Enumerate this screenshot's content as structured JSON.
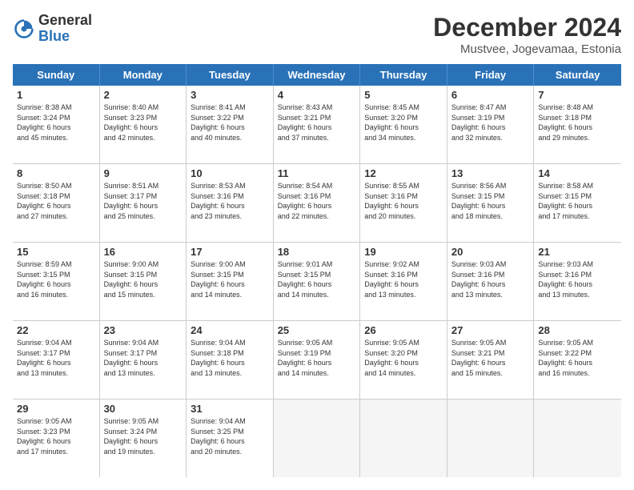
{
  "logo": {
    "line1": "General",
    "line2": "Blue"
  },
  "title": "December 2024",
  "subtitle": "Mustvee, Jogevamaa, Estonia",
  "header_days": [
    "Sunday",
    "Monday",
    "Tuesday",
    "Wednesday",
    "Thursday",
    "Friday",
    "Saturday"
  ],
  "weeks": [
    [
      {
        "day": "1",
        "info": "Sunrise: 8:38 AM\nSunset: 3:24 PM\nDaylight: 6 hours\nand 45 minutes."
      },
      {
        "day": "2",
        "info": "Sunrise: 8:40 AM\nSunset: 3:23 PM\nDaylight: 6 hours\nand 42 minutes."
      },
      {
        "day": "3",
        "info": "Sunrise: 8:41 AM\nSunset: 3:22 PM\nDaylight: 6 hours\nand 40 minutes."
      },
      {
        "day": "4",
        "info": "Sunrise: 8:43 AM\nSunset: 3:21 PM\nDaylight: 6 hours\nand 37 minutes."
      },
      {
        "day": "5",
        "info": "Sunrise: 8:45 AM\nSunset: 3:20 PM\nDaylight: 6 hours\nand 34 minutes."
      },
      {
        "day": "6",
        "info": "Sunrise: 8:47 AM\nSunset: 3:19 PM\nDaylight: 6 hours\nand 32 minutes."
      },
      {
        "day": "7",
        "info": "Sunrise: 8:48 AM\nSunset: 3:18 PM\nDaylight: 6 hours\nand 29 minutes."
      }
    ],
    [
      {
        "day": "8",
        "info": "Sunrise: 8:50 AM\nSunset: 3:18 PM\nDaylight: 6 hours\nand 27 minutes."
      },
      {
        "day": "9",
        "info": "Sunrise: 8:51 AM\nSunset: 3:17 PM\nDaylight: 6 hours\nand 25 minutes."
      },
      {
        "day": "10",
        "info": "Sunrise: 8:53 AM\nSunset: 3:16 PM\nDaylight: 6 hours\nand 23 minutes."
      },
      {
        "day": "11",
        "info": "Sunrise: 8:54 AM\nSunset: 3:16 PM\nDaylight: 6 hours\nand 22 minutes."
      },
      {
        "day": "12",
        "info": "Sunrise: 8:55 AM\nSunset: 3:16 PM\nDaylight: 6 hours\nand 20 minutes."
      },
      {
        "day": "13",
        "info": "Sunrise: 8:56 AM\nSunset: 3:15 PM\nDaylight: 6 hours\nand 18 minutes."
      },
      {
        "day": "14",
        "info": "Sunrise: 8:58 AM\nSunset: 3:15 PM\nDaylight: 6 hours\nand 17 minutes."
      }
    ],
    [
      {
        "day": "15",
        "info": "Sunrise: 8:59 AM\nSunset: 3:15 PM\nDaylight: 6 hours\nand 16 minutes."
      },
      {
        "day": "16",
        "info": "Sunrise: 9:00 AM\nSunset: 3:15 PM\nDaylight: 6 hours\nand 15 minutes."
      },
      {
        "day": "17",
        "info": "Sunrise: 9:00 AM\nSunset: 3:15 PM\nDaylight: 6 hours\nand 14 minutes."
      },
      {
        "day": "18",
        "info": "Sunrise: 9:01 AM\nSunset: 3:15 PM\nDaylight: 6 hours\nand 14 minutes."
      },
      {
        "day": "19",
        "info": "Sunrise: 9:02 AM\nSunset: 3:16 PM\nDaylight: 6 hours\nand 13 minutes."
      },
      {
        "day": "20",
        "info": "Sunrise: 9:03 AM\nSunset: 3:16 PM\nDaylight: 6 hours\nand 13 minutes."
      },
      {
        "day": "21",
        "info": "Sunrise: 9:03 AM\nSunset: 3:16 PM\nDaylight: 6 hours\nand 13 minutes."
      }
    ],
    [
      {
        "day": "22",
        "info": "Sunrise: 9:04 AM\nSunset: 3:17 PM\nDaylight: 6 hours\nand 13 minutes."
      },
      {
        "day": "23",
        "info": "Sunrise: 9:04 AM\nSunset: 3:17 PM\nDaylight: 6 hours\nand 13 minutes."
      },
      {
        "day": "24",
        "info": "Sunrise: 9:04 AM\nSunset: 3:18 PM\nDaylight: 6 hours\nand 13 minutes."
      },
      {
        "day": "25",
        "info": "Sunrise: 9:05 AM\nSunset: 3:19 PM\nDaylight: 6 hours\nand 14 minutes."
      },
      {
        "day": "26",
        "info": "Sunrise: 9:05 AM\nSunset: 3:20 PM\nDaylight: 6 hours\nand 14 minutes."
      },
      {
        "day": "27",
        "info": "Sunrise: 9:05 AM\nSunset: 3:21 PM\nDaylight: 6 hours\nand 15 minutes."
      },
      {
        "day": "28",
        "info": "Sunrise: 9:05 AM\nSunset: 3:22 PM\nDaylight: 6 hours\nand 16 minutes."
      }
    ],
    [
      {
        "day": "29",
        "info": "Sunrise: 9:05 AM\nSunset: 3:23 PM\nDaylight: 6 hours\nand 17 minutes."
      },
      {
        "day": "30",
        "info": "Sunrise: 9:05 AM\nSunset: 3:24 PM\nDaylight: 6 hours\nand 19 minutes."
      },
      {
        "day": "31",
        "info": "Sunrise: 9:04 AM\nSunset: 3:25 PM\nDaylight: 6 hours\nand 20 minutes."
      },
      {
        "day": "",
        "info": ""
      },
      {
        "day": "",
        "info": ""
      },
      {
        "day": "",
        "info": ""
      },
      {
        "day": "",
        "info": ""
      }
    ]
  ]
}
